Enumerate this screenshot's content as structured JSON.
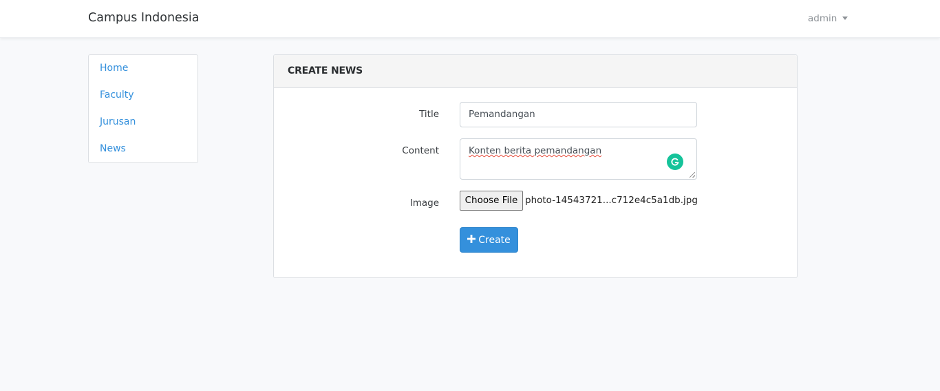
{
  "navbar": {
    "brand": "Campus Indonesia",
    "user": "admin"
  },
  "sidebar": {
    "items": [
      {
        "label": "Home"
      },
      {
        "label": "Faculty"
      },
      {
        "label": "Jurusan"
      },
      {
        "label": "News"
      }
    ]
  },
  "form": {
    "header": "CREATE NEWS",
    "title_label": "Title",
    "title_value": "Pemandangan",
    "content_label": "Content",
    "content_value": "Konten berita pemandangan",
    "image_label": "Image",
    "file_button": "Choose File",
    "file_name": "photo-14543721...c712e4c5a1db.jpg",
    "submit_label": "Create"
  },
  "icons": {
    "plus": "plus-icon",
    "caret": "caret-down-icon",
    "grammarly": "grammarly-icon"
  },
  "colors": {
    "accent": "#3490dc",
    "grammarly": "#15c39a"
  }
}
